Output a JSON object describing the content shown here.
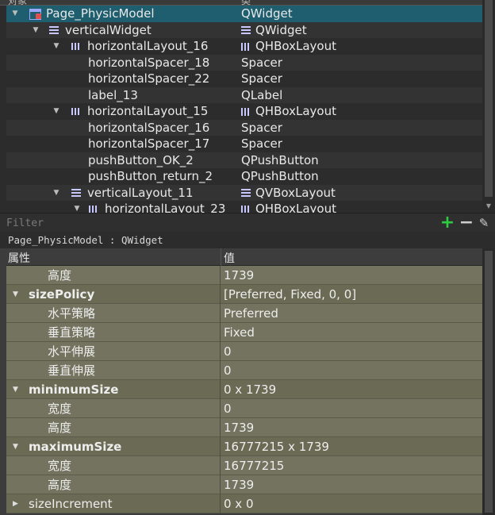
{
  "object_inspector": {
    "column_object": "对象",
    "column_class": "类",
    "rows": [
      {
        "name": "Page_PhysicModel",
        "class": "QWidget",
        "icon": "page-icon",
        "depth": 0,
        "arrow": "expanded"
      },
      {
        "name": "verticalWidget",
        "class": "QWidget",
        "icon": "vbox-icon",
        "depth": 1,
        "arrow": "expanded"
      },
      {
        "name": "horizontalLayout_16",
        "class": "QHBoxLayout",
        "icon": "hbox-icon",
        "depth": 2,
        "arrow": "expanded"
      },
      {
        "name": "horizontalSpacer_18",
        "class": "Spacer",
        "icon": "",
        "depth": 3,
        "arrow": ""
      },
      {
        "name": "horizontalSpacer_22",
        "class": "Spacer",
        "icon": "",
        "depth": 3,
        "arrow": ""
      },
      {
        "name": "label_13",
        "class": "QLabel",
        "icon": "",
        "depth": 3,
        "arrow": ""
      },
      {
        "name": "horizontalLayout_15",
        "class": "QHBoxLayout",
        "icon": "hbox-icon",
        "depth": 2,
        "arrow": "expanded"
      },
      {
        "name": "horizontalSpacer_16",
        "class": "Spacer",
        "icon": "",
        "depth": 3,
        "arrow": ""
      },
      {
        "name": "horizontalSpacer_17",
        "class": "Spacer",
        "icon": "",
        "depth": 3,
        "arrow": ""
      },
      {
        "name": "pushButton_OK_2",
        "class": "QPushButton",
        "icon": "",
        "depth": 3,
        "arrow": ""
      },
      {
        "name": "pushButton_return_2",
        "class": "QPushButton",
        "icon": "",
        "depth": 3,
        "arrow": ""
      },
      {
        "name": "verticalLayout_11",
        "class": "QVBoxLayout",
        "icon": "vbox-icon",
        "depth": 2,
        "arrow": "expanded"
      },
      {
        "name": "horizontalLayout_23",
        "class": "QHBoxLayout",
        "icon": "hbox-icon",
        "depth": 3,
        "arrow": "expanded"
      }
    ]
  },
  "filter": {
    "placeholder": "Filter",
    "add_label": "+",
    "remove_label": "−",
    "tool_label": "✎"
  },
  "selected_object": "Page_PhysicModel : QWidget",
  "property_editor": {
    "column_property": "属性",
    "column_value": "值",
    "rows": [
      {
        "name": "高度",
        "value": "1739",
        "kind": "sub",
        "arrow": ""
      },
      {
        "name": "sizePolicy",
        "value": "[Preferred, Fixed, 0, 0]",
        "kind": "grp",
        "arrow": "expanded"
      },
      {
        "name": "水平策略",
        "value": "Preferred",
        "kind": "sub",
        "arrow": ""
      },
      {
        "name": "垂直策略",
        "value": "Fixed",
        "kind": "sub",
        "arrow": ""
      },
      {
        "name": "水平伸展",
        "value": "0",
        "kind": "sub",
        "arrow": ""
      },
      {
        "name": "垂直伸展",
        "value": "0",
        "kind": "sub",
        "arrow": ""
      },
      {
        "name": "minimumSize",
        "value": "0 x 1739",
        "kind": "grp",
        "arrow": "expanded"
      },
      {
        "name": "宽度",
        "value": "0",
        "kind": "sub",
        "arrow": ""
      },
      {
        "name": "高度",
        "value": "1739",
        "kind": "sub",
        "arrow": ""
      },
      {
        "name": "maximumSize",
        "value": "16777215 x 1739",
        "kind": "grp",
        "arrow": "expanded"
      },
      {
        "name": "宽度",
        "value": "16777215",
        "kind": "sub",
        "arrow": ""
      },
      {
        "name": "高度",
        "value": "1739",
        "kind": "sub",
        "arrow": ""
      },
      {
        "name": "sizeIncrement",
        "value": "0 x 0",
        "kind": "grp-plain",
        "arrow": "collapsed"
      }
    ]
  },
  "colors": {
    "selection": "#1e5e6e",
    "group_row": "#6b6b55",
    "sub_row": "#737360",
    "add_green": "#2ecc40"
  }
}
